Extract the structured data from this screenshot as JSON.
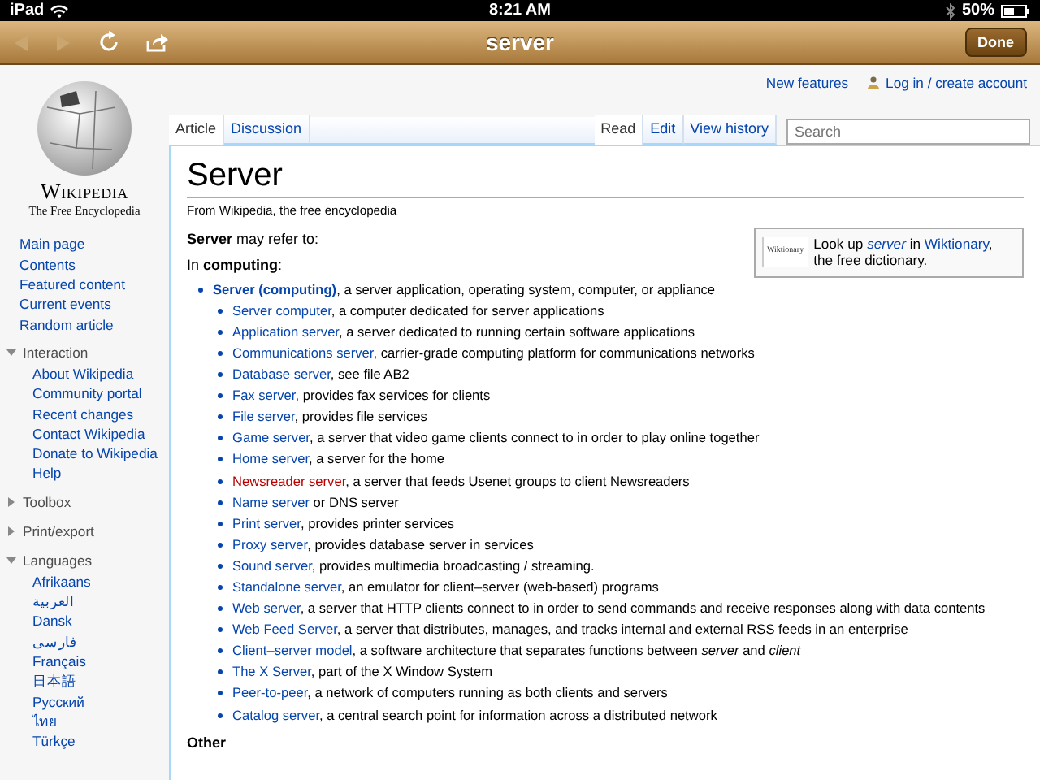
{
  "status_bar": {
    "device": "iPad",
    "time": "8:21 AM",
    "battery": "50%"
  },
  "toolbar": {
    "title": "server",
    "back_disabled": true,
    "forward_disabled": true,
    "done": "Done"
  },
  "personal": {
    "links": [
      "New features",
      "Log in / create account"
    ]
  },
  "sidebar": {
    "logo_title": "Wikipedia",
    "logo_subtitle": "The Free Encyclopedia",
    "nav": [
      "Main page",
      "Contents",
      "Featured content",
      "Current events",
      "Random article"
    ],
    "sections": [
      {
        "label": "Interaction",
        "expanded": true,
        "items": [
          "About Wikipedia",
          "Community portal",
          "Recent changes",
          "Contact Wikipedia",
          "Donate to Wikipedia",
          "Help"
        ]
      },
      {
        "label": "Toolbox",
        "expanded": false
      },
      {
        "label": "Print/export",
        "expanded": false
      },
      {
        "label": "Languages",
        "expanded": true,
        "items": [
          "Afrikaans",
          "العربية",
          "Dansk",
          "فارسی",
          "Français",
          "日本語",
          "Русский",
          "ไทย",
          "Türkçe"
        ]
      }
    ]
  },
  "tabs_left": [
    {
      "label": "Article",
      "selected": true
    },
    {
      "label": "Discussion",
      "selected": false
    }
  ],
  "tabs_right": [
    {
      "label": "Read",
      "selected": true
    },
    {
      "label": "Edit",
      "selected": false
    },
    {
      "label": "View history",
      "selected": false
    }
  ],
  "search": {
    "placeholder": "Search"
  },
  "article": {
    "title": "Server",
    "tagline": "From Wikipedia, the free encyclopedia",
    "intro": "**Server** may refer to:",
    "section_intro": "In **computing**:",
    "wiktionary": {
      "logo_text": "Wiktionary",
      "parts": [
        {
          "text": "Look up ",
          "kind": "plain"
        },
        {
          "text": "server",
          "kind": "link",
          "italic": true
        },
        {
          "text": " in ",
          "kind": "plain"
        },
        {
          "text": "Wiktionary",
          "kind": "link"
        },
        {
          "text": ", the free dictionary.",
          "kind": "plain"
        }
      ]
    },
    "items": [
      {
        "link": "Server (computing)",
        "kind": "link",
        "bold": true,
        "rest": ", a server application, operating system, computer, or appliance",
        "children": [
          {
            "link": "Server computer",
            "kind": "link",
            "bold": false,
            "rest": ", a computer dedicated for server applications"
          },
          {
            "link": "Application server",
            "kind": "link",
            "bold": false,
            "rest": ", a server dedicated to running certain software applications"
          },
          {
            "link": "Communications server",
            "kind": "link",
            "bold": false,
            "rest": ", carrier-grade computing platform for communications networks"
          },
          {
            "link": "Database server",
            "kind": "link",
            "bold": false,
            "rest": ", see file AB2"
          },
          {
            "link": "Fax server",
            "kind": "link",
            "bold": false,
            "rest": ", provides fax services for clients"
          },
          {
            "link": "File server",
            "kind": "link",
            "bold": false,
            "rest": ", provides file services"
          },
          {
            "link": "Game server",
            "kind": "link",
            "bold": false,
            "rest": ", a server that video game clients connect to in order to play online together"
          },
          {
            "link": "Home server",
            "kind": "link",
            "bold": false,
            "rest": ", a server for the home"
          },
          {
            "link": "Newsreader server",
            "kind": "newlink",
            "bold": false,
            "rest": ", a server that feeds Usenet groups to client Newsreaders"
          },
          {
            "link": "Name server",
            "kind": "link",
            "bold": false,
            "rest": " or DNS server"
          },
          {
            "link": "Print server",
            "kind": "link",
            "bold": false,
            "rest": ", provides printer services"
          },
          {
            "link": "Proxy server",
            "kind": "link",
            "bold": false,
            "rest": ", provides database server in services"
          },
          {
            "link": "Sound server",
            "kind": "link",
            "bold": false,
            "rest": ", provides multimedia broadcasting / streaming."
          },
          {
            "link": "Standalone server",
            "kind": "link",
            "bold": false,
            "rest": ", an emulator for client–server (web-based) programs"
          },
          {
            "link": "Web server",
            "kind": "link",
            "bold": false,
            "rest": ", a server that HTTP clients connect to in order to send commands and receive responses along with data contents"
          },
          {
            "link": "Web Feed Server",
            "kind": "link",
            "bold": false,
            "rest": ", a server that distributes, manages, and tracks internal and external RSS feeds in an enterprise"
          },
          {
            "link": "Client–server model",
            "kind": "link",
            "bold": false,
            "rest": ", a software architecture that separates functions between *server* and *client*"
          },
          {
            "link": "The X Server",
            "kind": "link",
            "bold": false,
            "rest": ", part of the X Window System"
          },
          {
            "link": "Peer-to-peer",
            "kind": "link",
            "bold": false,
            "rest": ", a network of computers running as both clients and servers"
          },
          {
            "link": "Catalog server",
            "kind": "link",
            "bold": false,
            "rest": ", a central search point for information across a distributed network"
          }
        ]
      }
    ],
    "other_heading": "Other"
  }
}
